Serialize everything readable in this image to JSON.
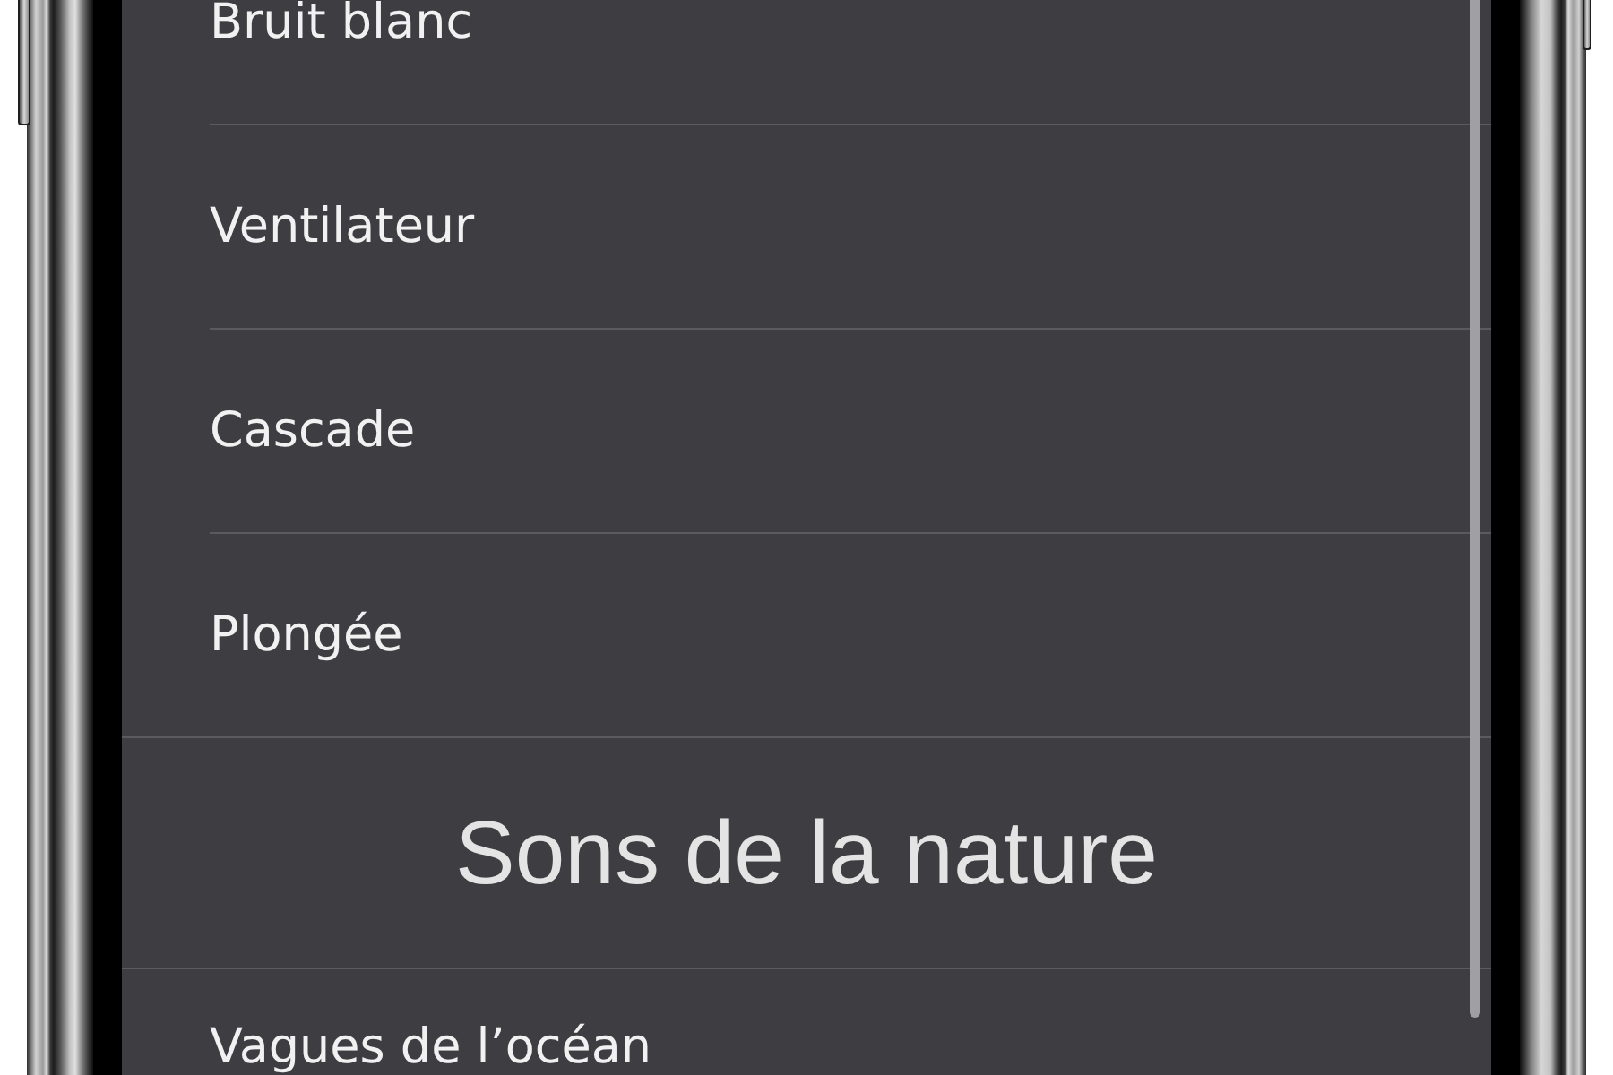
{
  "list": {
    "rows": [
      {
        "kind": "item",
        "label": "Bruit blanc"
      },
      {
        "kind": "item",
        "label": "Ventilateur"
      },
      {
        "kind": "item",
        "label": "Cascade"
      },
      {
        "kind": "item",
        "label": "Plongée"
      },
      {
        "kind": "header",
        "label": "Sons de la nature"
      },
      {
        "kind": "item",
        "label": "Vagues de l’océan"
      }
    ]
  }
}
